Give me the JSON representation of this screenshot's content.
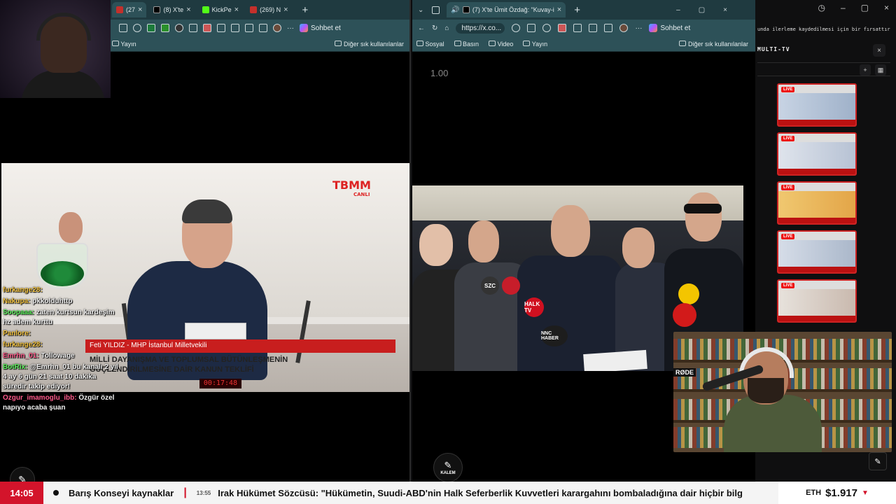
{
  "left_browser": {
    "tabs": [
      {
        "label": "(27",
        "favicon": "youtube"
      },
      {
        "label": "(8) X'te",
        "favicon": "x"
      },
      {
        "label": "KickPe",
        "favicon": "kick"
      },
      {
        "label": "(269) N",
        "favicon": "youtube"
      }
    ],
    "new_tab_glyph": "+",
    "copilot_label": "Sohbet et",
    "bookmarks": [
      {
        "label": "Yayın"
      }
    ],
    "other_bookmarks": "Diğer sık kullanılanlar"
  },
  "left_video": {
    "logo_text": "TBMM",
    "logo_sub": "CANLI",
    "name_strap": "Feti YILDIZ - MHP İstanbul Milletvekili",
    "headline_line1": "MİLLİ DAYANIŞMA VE TOPLUMSAL BÜTÜNLEŞMENİN",
    "headline_line2": "GÜÇLENDİRİLMESİNE DAİR KANUN TEKLİFİ",
    "clock": "00:17:48"
  },
  "chat": [
    {
      "user": "furkange28:",
      "msg": "",
      "color": "yellow"
    },
    {
      "user": "Nakupa:",
      "msg": "pkkolduhttp",
      "color": "yellow"
    },
    {
      "user": "Soopaaa:",
      "msg": "zaten kurtsun kardeşim hz adem kurttu",
      "color": "green"
    },
    {
      "user": "Panlore:",
      "msg": "",
      "color": "yellow"
    },
    {
      "user": "furkange28:",
      "msg": "",
      "color": "yellow"
    },
    {
      "user": "Emrhn_01:",
      "msg": "Tollowage",
      "color": "pink"
    },
    {
      "user": "BotRix:",
      "msg": "@Emrhn_01 bu kanalı 2 yıl 4 ay 6 gün 21 saat 10 dakika süredir takip ediyor!",
      "color": "green"
    },
    {
      "user": "Ozgur_imamoglu_ibb:",
      "msg": "Özgür özel napıyo acaba şuan",
      "color": "pink"
    }
  ],
  "right_browser": {
    "tab_title": "(7) X'te Ümit Özdağ: \"Kuvay-i",
    "url": "https://x.co...",
    "copilot_label": "Sohbet et",
    "bookmarks": [
      {
        "label": "Sosyal"
      },
      {
        "label": "Basın"
      },
      {
        "label": "Video"
      },
      {
        "label": "Yayın"
      }
    ],
    "other_bookmarks": "Diğer sık kullanılanlar",
    "zoom_text": "1.00",
    "button_label": "KALEM"
  },
  "right_video": {
    "mic_badges": [
      "SZC",
      "NNC HABER",
      "HALK TV"
    ]
  },
  "sidebar": {
    "banner": "unda ilerleme kaydedilmesi için bir fırsattır",
    "panel_title": "MULTI-TV",
    "thumbs": [
      {
        "badge": "LIVE"
      },
      {
        "badge": "LIVE"
      },
      {
        "badge": "LIVE"
      },
      {
        "badge": "LIVE"
      },
      {
        "badge": "LIVE"
      }
    ]
  },
  "webcam_right": {
    "mic_brand": "RØDE"
  },
  "ticker": {
    "time": "14:05",
    "text1": "Barış Konseyi kaynaklar",
    "stamp": "13:55",
    "text2": "Irak Hükümet Sözcüsü: \"Hükümetin, Suudi-ABD'nin Halk Seferberlik Kuvvetleri karargahını bombaladığına dair hiçbir bilg",
    "eth_symbol": "ETH",
    "eth_price": "$1.917",
    "eth_arrow": "▼"
  },
  "colors": {
    "ticker_red": "#d3142b",
    "browser_chrome": "#2d5158",
    "live_red": "#e11111"
  }
}
